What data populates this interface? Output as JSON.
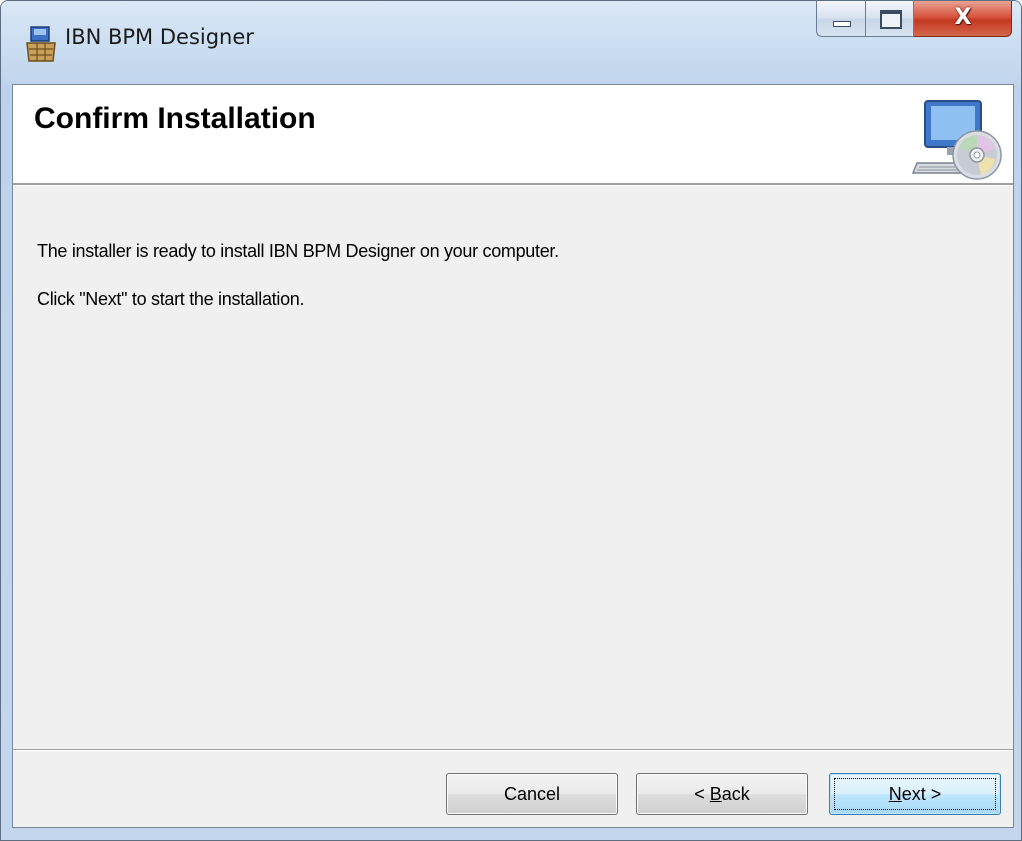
{
  "window": {
    "title": "IBN BPM Designer",
    "close_glyph": "X",
    "icons": {
      "app": "installer-package-icon",
      "banner": "computer-cd-icon"
    }
  },
  "banner": {
    "title": "Confirm Installation"
  },
  "content": {
    "line1": "The installer is ready to install IBN BPM Designer on your computer.",
    "line2": "Click \"Next\" to start the installation."
  },
  "buttons": {
    "cancel": "Cancel",
    "back_prefix": "< ",
    "back_mnemonic": "B",
    "back_rest": "ack",
    "next_mnemonic": "N",
    "next_rest": "ext >"
  },
  "colors": {
    "accent": "#3c7fb1",
    "close_button": "#c53a22"
  }
}
